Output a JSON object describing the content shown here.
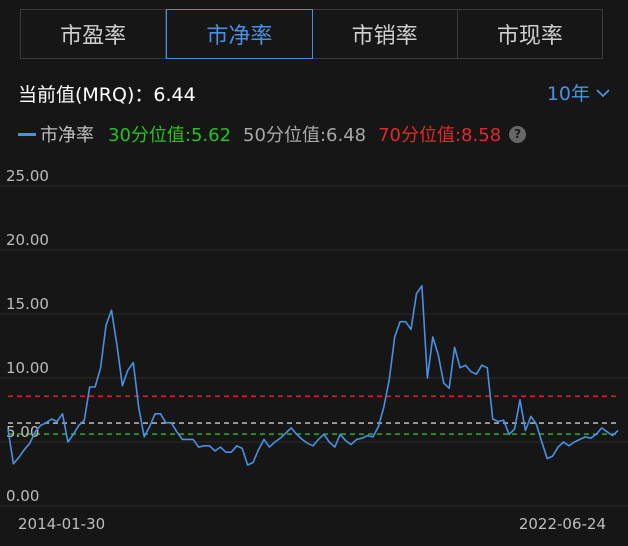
{
  "tabs": [
    {
      "label": "市盈率",
      "active": false
    },
    {
      "label": "市净率",
      "active": true
    },
    {
      "label": "市销率",
      "active": false
    },
    {
      "label": "市现率",
      "active": false
    }
  ],
  "metric": {
    "label": "当前值(MRQ)：",
    "value": "6.44"
  },
  "period": {
    "label": "10年"
  },
  "legend": {
    "series_name": "市净率",
    "p30_label": "30分位值:5.62",
    "p50_label": "50分位值:6.48",
    "p70_label": "70分位值:8.58",
    "help_glyph": "?"
  },
  "colors": {
    "accent": "#4a90e2",
    "p30": "#22c322",
    "p50": "#cccccc",
    "p70": "#e02a2a"
  },
  "chart_data": {
    "type": "line",
    "y_ticks": [
      "25.00",
      "20.00",
      "15.00",
      "10.00",
      "5.00",
      "0.00"
    ],
    "ylim": [
      0,
      25
    ],
    "x_start_label": "2014-01-30",
    "x_end_label": "2022-06-24",
    "reference_lines": [
      {
        "name": "70分位值",
        "value": 8.58,
        "color": "#e02a2a"
      },
      {
        "name": "50分位值",
        "value": 6.48,
        "color": "#cccccc"
      },
      {
        "name": "30分位值",
        "value": 5.62,
        "color": "#22c322"
      }
    ],
    "series": [
      {
        "name": "市净率",
        "color": "#4a90e2",
        "values": [
          6.0,
          3.3,
          3.8,
          4.4,
          4.9,
          5.8,
          6.3,
          6.5,
          6.8,
          6.6,
          7.2,
          5.0,
          5.6,
          6.3,
          6.7,
          9.3,
          9.3,
          10.8,
          14.1,
          15.3,
          12.6,
          9.4,
          10.6,
          11.2,
          7.7,
          5.4,
          6.2,
          7.2,
          7.2,
          6.5,
          6.5,
          5.8,
          5.2,
          5.2,
          5.2,
          4.6,
          4.7,
          4.7,
          4.3,
          4.6,
          4.2,
          4.2,
          4.7,
          4.5,
          3.2,
          3.4,
          4.4,
          5.2,
          4.6,
          5.0,
          5.3,
          5.7,
          6.1,
          5.6,
          5.2,
          4.9,
          4.7,
          5.2,
          5.6,
          5.0,
          4.6,
          5.6,
          5.1,
          4.8,
          5.2,
          5.3,
          5.5,
          5.4,
          6.2,
          7.7,
          9.9,
          13.2,
          14.4,
          14.4,
          13.8,
          16.6,
          17.2,
          10.0,
          13.2,
          11.8,
          9.6,
          9.2,
          12.4,
          10.8,
          11.0,
          10.5,
          10.3,
          11.0,
          10.8,
          6.8,
          6.6,
          6.7,
          5.6,
          6.0,
          8.3,
          5.9,
          7.0,
          6.4,
          5.0,
          3.7,
          3.9,
          4.6,
          5.0,
          4.7,
          5.0,
          5.2,
          5.4,
          5.3,
          5.6,
          6.1,
          5.8,
          5.5,
          5.9
        ]
      }
    ]
  }
}
